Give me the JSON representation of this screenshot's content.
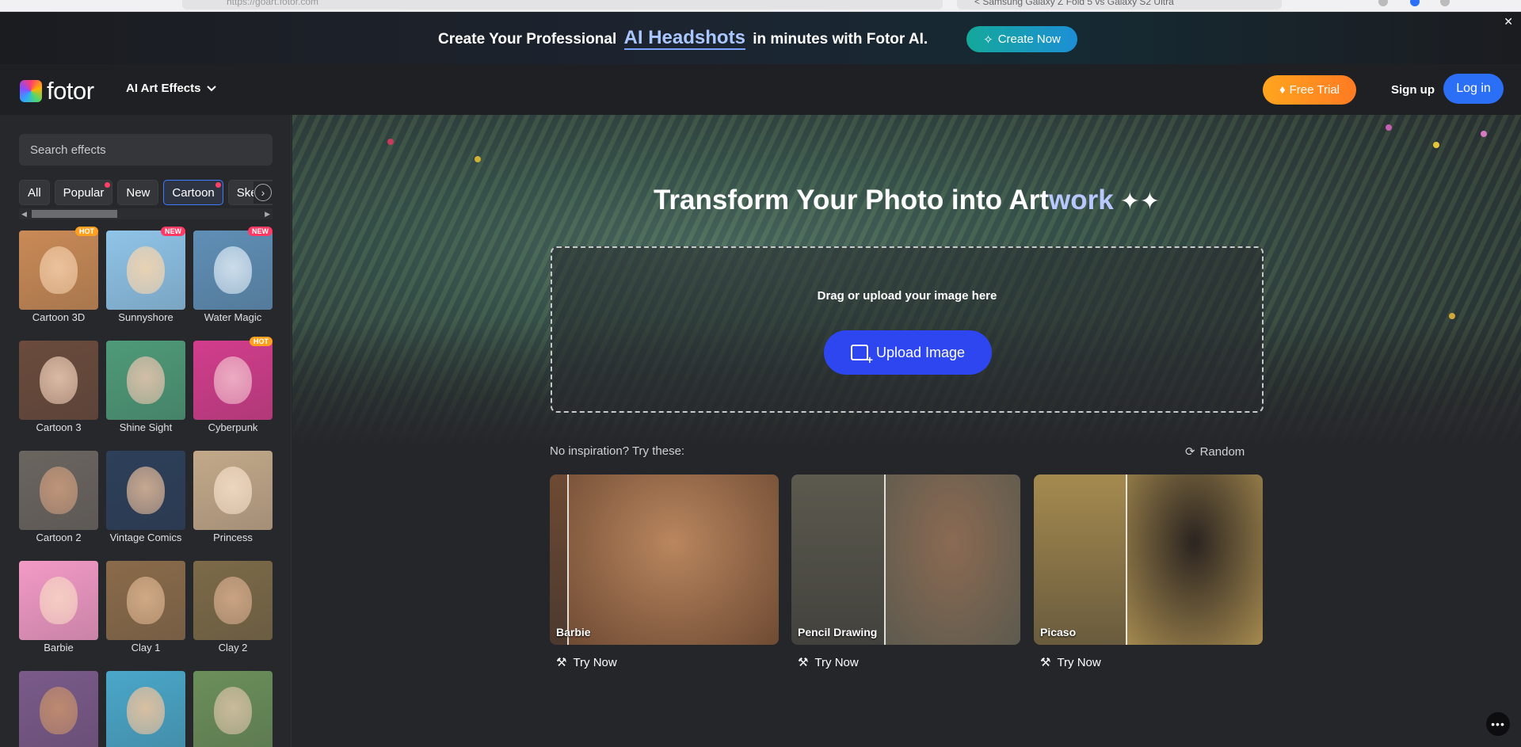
{
  "browser": {
    "url": "https://goart.fotor.com",
    "other_tab": "< Samsung Galaxy Z Fold 5 vs Galaxy S2 Ultra"
  },
  "promo": {
    "text_before": "Create Your Professional",
    "highlight": "AI Headshots",
    "text_after": "in minutes with Fotor AI.",
    "button": "Create Now",
    "close": "✕"
  },
  "header": {
    "logo": "fotor",
    "menu": "AI Art Effects",
    "free_trial": "Free Trial",
    "sign_up": "Sign up",
    "log_in": "Log in"
  },
  "sidebar": {
    "search_placeholder": "Search effects",
    "filters": [
      {
        "label": "All"
      },
      {
        "label": "Popular"
      },
      {
        "label": "New"
      },
      {
        "label": "Cartoon"
      },
      {
        "label": "Sketch"
      }
    ],
    "effects": [
      {
        "label": "Cartoon 3D",
        "badge": "HOT"
      },
      {
        "label": "Sunnyshore",
        "badge": "NEW"
      },
      {
        "label": "Water Magic",
        "badge": "NEW"
      },
      {
        "label": "Cartoon 3",
        "badge": ""
      },
      {
        "label": "Shine Sight",
        "badge": ""
      },
      {
        "label": "Cyberpunk",
        "badge": "HOT"
      },
      {
        "label": "Cartoon 2",
        "badge": ""
      },
      {
        "label": "Vintage Comics",
        "badge": ""
      },
      {
        "label": "Princess",
        "badge": ""
      },
      {
        "label": "Barbie",
        "badge": ""
      },
      {
        "label": "Clay 1",
        "badge": ""
      },
      {
        "label": "Clay 2",
        "badge": ""
      },
      {
        "label": "",
        "badge": ""
      },
      {
        "label": "",
        "badge": ""
      },
      {
        "label": "",
        "badge": ""
      }
    ],
    "thumb_colors": [
      [
        "#c98a56",
        "#f0c9a4"
      ],
      [
        "#8fc4e8",
        "#f4d5b0"
      ],
      [
        "#5f8fb6",
        "#d7e6f2"
      ],
      [
        "#6a4b3c",
        "#e8c6b0"
      ],
      [
        "#4e9a78",
        "#e2c3ad"
      ],
      [
        "#d23d8c",
        "#f0b7c8"
      ],
      [
        "#6b6560",
        "#c79a7c"
      ],
      [
        "#2d3f5a",
        "#d8b497"
      ],
      [
        "#c3a98a",
        "#f2dcc5"
      ],
      [
        "#f29ac6",
        "#f7d3c4"
      ],
      [
        "#8a6b4a",
        "#d8b08c"
      ],
      [
        "#7c6a48",
        "#d2a98a"
      ],
      [
        "#7a5a8a",
        "#c58f6d"
      ],
      [
        "#4aa7c9",
        "#e9c39f"
      ],
      [
        "#6b8f5a",
        "#d4c0a4"
      ]
    ]
  },
  "hero": {
    "title_main": "Transform Your Photo into Art",
    "title_accent": "work",
    "drop_text": "Drag or upload your image here",
    "upload_button": "Upload Image"
  },
  "inspiration": {
    "prompt": "No inspiration? Try these:",
    "random": "Random",
    "samples": [
      {
        "name": "Barbie",
        "try": "Try Now",
        "left_color": "#6e4a33",
        "right_color": "#b9865e"
      },
      {
        "name": "Pencil Drawing",
        "try": "Try Now",
        "left_color": "#5c5a4e",
        "right_color": "#8b6a52"
      },
      {
        "name": "Picaso",
        "try": "Try Now",
        "left_color": "#a58a4f",
        "right_color": "#2b2420"
      }
    ]
  },
  "fab": "•••"
}
